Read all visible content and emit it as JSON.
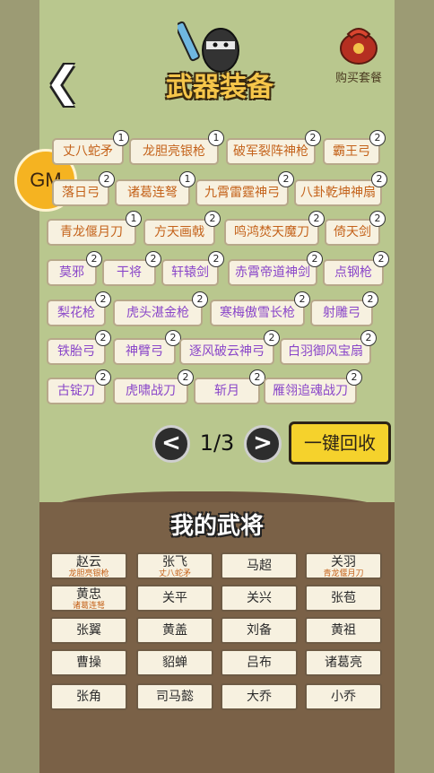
{
  "header": {
    "back_glyph": "❮",
    "title": "武器装备",
    "pack_label": "购买套餐"
  },
  "gm_label": "GM",
  "weapons": [
    {
      "name": "丈八蛇矛",
      "lvl": "1",
      "color": "orange"
    },
    {
      "name": "龙胆亮银枪",
      "lvl": "1",
      "color": "orange"
    },
    {
      "name": "破军裂阵神枪",
      "lvl": "2",
      "color": "orange"
    },
    {
      "name": "霸王弓",
      "lvl": "2",
      "color": "orange"
    },
    {
      "name": "落日弓",
      "lvl": "2",
      "color": "orange"
    },
    {
      "name": "诸葛连弩",
      "lvl": "1",
      "color": "orange"
    },
    {
      "name": "九霄雷霆神弓",
      "lvl": "2",
      "color": "orange"
    },
    {
      "name": "八卦乾坤神扇",
      "lvl": "2",
      "color": "orange"
    },
    {
      "name": "青龙偃月刀",
      "lvl": "1",
      "color": "orange"
    },
    {
      "name": "方天画戟",
      "lvl": "2",
      "color": "orange"
    },
    {
      "name": "鸣鸿焚天魔刀",
      "lvl": "2",
      "color": "orange"
    },
    {
      "name": "倚天剑",
      "lvl": "2",
      "color": "orange"
    },
    {
      "name": "莫邪",
      "lvl": "2",
      "color": "purple"
    },
    {
      "name": "干将",
      "lvl": "2",
      "color": "purple"
    },
    {
      "name": "轩辕剑",
      "lvl": "2",
      "color": "purple"
    },
    {
      "name": "赤霄帝道神剑",
      "lvl": "2",
      "color": "purple"
    },
    {
      "name": "点钢枪",
      "lvl": "2",
      "color": "purple"
    },
    {
      "name": "梨花枪",
      "lvl": "2",
      "color": "purple"
    },
    {
      "name": "虎头湛金枪",
      "lvl": "2",
      "color": "purple"
    },
    {
      "name": "寒梅傲雪长枪",
      "lvl": "2",
      "color": "purple"
    },
    {
      "name": "射雕弓",
      "lvl": "2",
      "color": "purple"
    },
    {
      "name": "铁胎弓",
      "lvl": "2",
      "color": "purple"
    },
    {
      "name": "神臂弓",
      "lvl": "2",
      "color": "purple"
    },
    {
      "name": "逐风破云神弓",
      "lvl": "2",
      "color": "purple"
    },
    {
      "name": "白羽御风宝扇",
      "lvl": "2",
      "color": "purple"
    },
    {
      "name": "古锭刀",
      "lvl": "2",
      "color": "purple"
    },
    {
      "name": "虎啸战刀",
      "lvl": "2",
      "color": "purple"
    },
    {
      "name": "斩月",
      "lvl": "2",
      "color": "purple"
    },
    {
      "name": "雁翎追魂战刀",
      "lvl": "2",
      "color": "purple"
    }
  ],
  "pager": {
    "prev_glyph": "<",
    "next_glyph": ">",
    "page": "1/3"
  },
  "recycle_label": "一键回收",
  "generals_heading": "我的武将",
  "generals": [
    {
      "name": "赵云",
      "weapon": "龙胆亮银枪"
    },
    {
      "name": "张飞",
      "weapon": "丈八蛇矛"
    },
    {
      "name": "马超",
      "weapon": ""
    },
    {
      "name": "关羽",
      "weapon": "青龙偃月刀"
    },
    {
      "name": "黄忠",
      "weapon": "诸葛连弩"
    },
    {
      "name": "关平",
      "weapon": ""
    },
    {
      "name": "关兴",
      "weapon": ""
    },
    {
      "name": "张苞",
      "weapon": ""
    },
    {
      "name": "张翼",
      "weapon": ""
    },
    {
      "name": "黄盖",
      "weapon": ""
    },
    {
      "name": "刘备",
      "weapon": ""
    },
    {
      "name": "黄祖",
      "weapon": ""
    },
    {
      "name": "曹操",
      "weapon": ""
    },
    {
      "name": "貂蝉",
      "weapon": ""
    },
    {
      "name": "吕布",
      "weapon": ""
    },
    {
      "name": "诸葛亮",
      "weapon": ""
    },
    {
      "name": "张角",
      "weapon": ""
    },
    {
      "name": "司马懿",
      "weapon": ""
    },
    {
      "name": "大乔",
      "weapon": ""
    },
    {
      "name": "小乔",
      "weapon": ""
    }
  ],
  "colors": {
    "orange": "#c4621a",
    "purple": "#8a46c9",
    "recycle": "#f5d22c"
  }
}
